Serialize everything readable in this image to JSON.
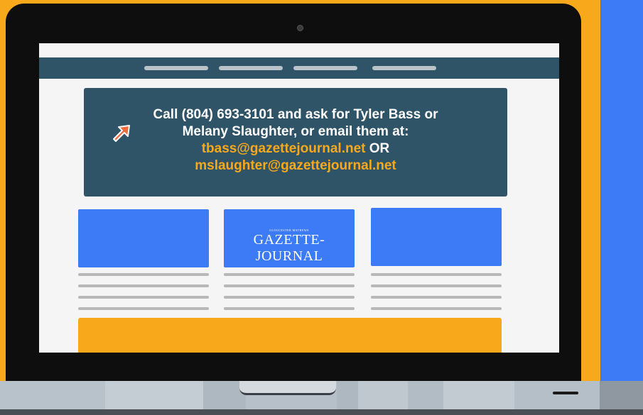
{
  "colors": {
    "background_orange": "#f7a81b",
    "accent_blue": "#3d7af5",
    "header_navy": "#2f5468",
    "email_orange": "#f7a81b"
  },
  "banner": {
    "line1": "Call (804) 693-3101 and ask for Tyler Bass or",
    "line2": "Melany Slaughter, or email them at:",
    "email1": "tbass@gazettejournal.net",
    "or_label": "OR",
    "email2": "mslaughter@gazettejournal.net",
    "arrow_icon": "cursor-arrow-icon"
  },
  "cards": {
    "logo_small_text": "GLOUCESTER MATHEWS",
    "logo_text": "GAZETTE-JOURNAL"
  },
  "icons": [
    "camera-icon",
    "cursor-arrow-icon"
  ]
}
